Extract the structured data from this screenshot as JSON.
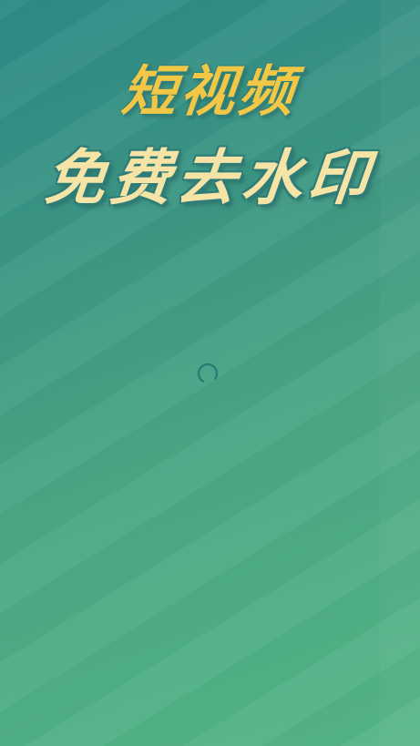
{
  "splash": {
    "title_line1": "短视频",
    "title_line2": "免费去水印",
    "colors": {
      "title_line1": "#f2c746",
      "title_line2": "#f6e3a6",
      "background_top": "#2e8a86",
      "background_bottom": "#55b686",
      "spinner": "#1f7f73"
    }
  },
  "loading": {
    "icon": "loading-spinner-icon"
  }
}
